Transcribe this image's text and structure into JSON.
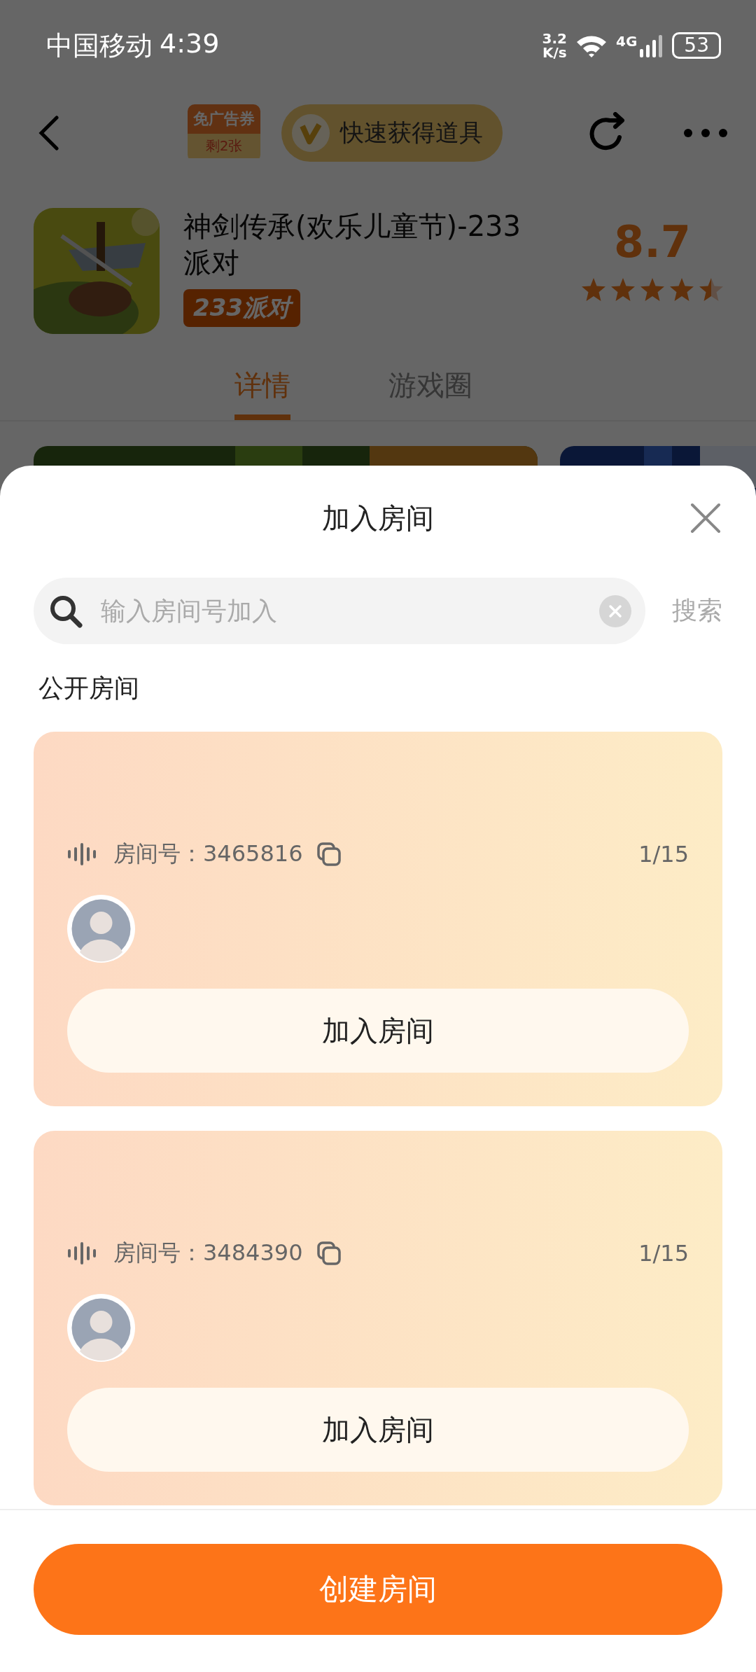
{
  "status_bar": {
    "carrier": "中国移动",
    "time": "4:39",
    "speed_value": "3.2",
    "speed_unit": "K/s",
    "network": "4G",
    "battery": "53"
  },
  "nav": {
    "voucher_title": "免广告券",
    "voucher_count": "剩2张",
    "promo": "快速获得道具"
  },
  "app": {
    "title": "神剑传承(欢乐儿童节)-233派对",
    "tag": "233派对",
    "rating": "8.7",
    "stars": 4.5
  },
  "tabs": [
    {
      "label": "详情",
      "selected": true
    },
    {
      "label": "游戏圈",
      "selected": false
    }
  ],
  "sheet": {
    "title": "加入房间",
    "search": {
      "placeholder": "输入房间号加入"
    },
    "search_button": "搜索",
    "section_title": "公开房间",
    "rooms": [
      {
        "room_number": "房间号：3465816",
        "count": "1/15",
        "join_button": "加入房间"
      },
      {
        "room_number": "房间号：3484390",
        "count": "1/15",
        "join_button": "加入房间"
      }
    ],
    "create_button": "创建房间"
  }
}
